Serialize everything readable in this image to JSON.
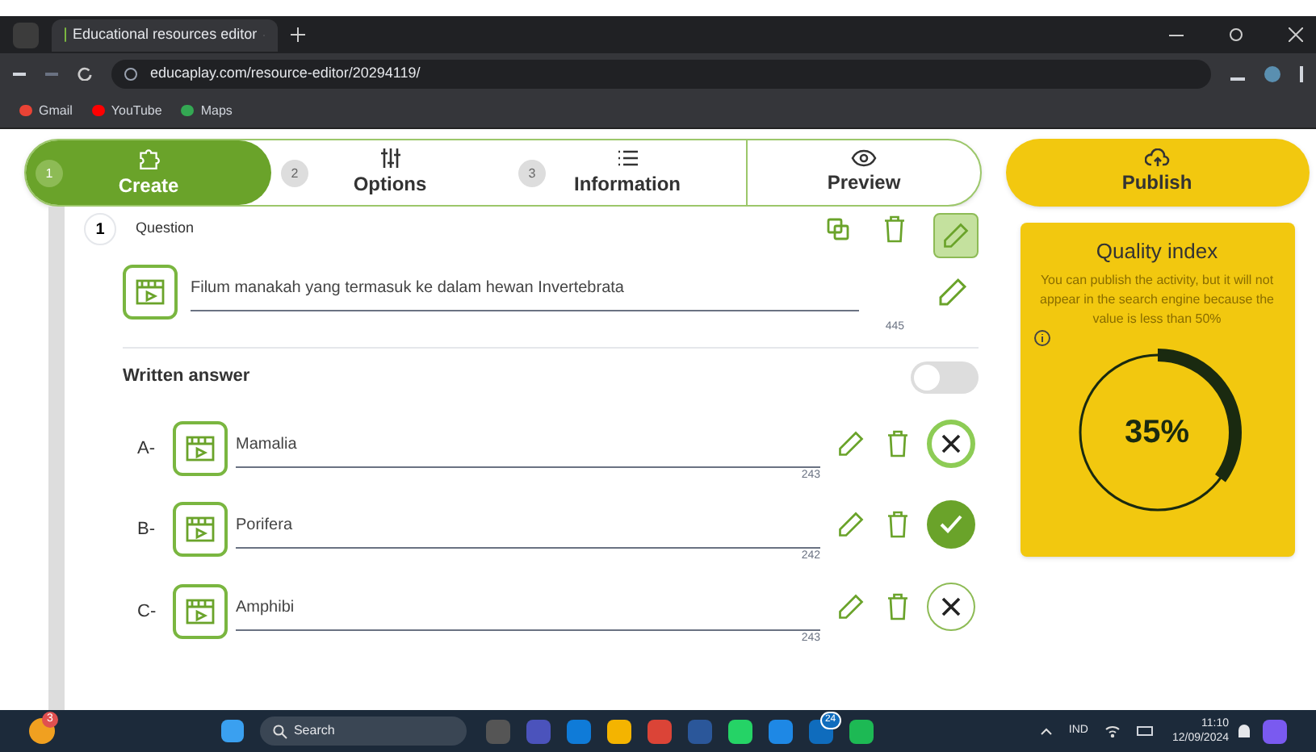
{
  "browser": {
    "tab_title": "Educational resources editor",
    "url": "educaplay.com/resource-editor/20294119/",
    "bookmarks": [
      {
        "label": "Gmail",
        "color": "#ea4335"
      },
      {
        "label": "YouTube",
        "color": "#ff0000"
      },
      {
        "label": "Maps",
        "color": "#34a853"
      }
    ]
  },
  "steps": [
    {
      "number": "1",
      "label": "Create",
      "selected": true
    },
    {
      "number": "2",
      "label": "Options",
      "selected": false
    },
    {
      "number": "3",
      "label": "Information",
      "selected": false
    }
  ],
  "preview": {
    "label": "Preview"
  },
  "publish": {
    "label": "Publish"
  },
  "quality": {
    "title": "Quality index",
    "message": "You can publish the activity, but it will not appear in the search engine because the value is less than 50%",
    "level": 0.35,
    "reading": "35%"
  },
  "question": {
    "number": "1",
    "label": "Question",
    "text": "Filum manakah yang termasuk ke dalam hewan Invertebrata",
    "count": "445"
  },
  "written_answer": {
    "label": "Written answer",
    "on": false
  },
  "answers": [
    {
      "letter": "A-",
      "text": "Mamalia",
      "count": "243",
      "correct": false,
      "highlighted": true
    },
    {
      "letter": "B-",
      "text": "Porifera",
      "count": "242",
      "correct": true,
      "highlighted": false
    },
    {
      "letter": "C-",
      "text": "Amphibi",
      "count": "243",
      "correct": false,
      "highlighted": false
    }
  ],
  "taskbar": {
    "notification_badge": "3",
    "search_placeholder": "Search",
    "app_badge": "24",
    "language": "IND",
    "time": "11:10",
    "date": "12/09/2024"
  }
}
